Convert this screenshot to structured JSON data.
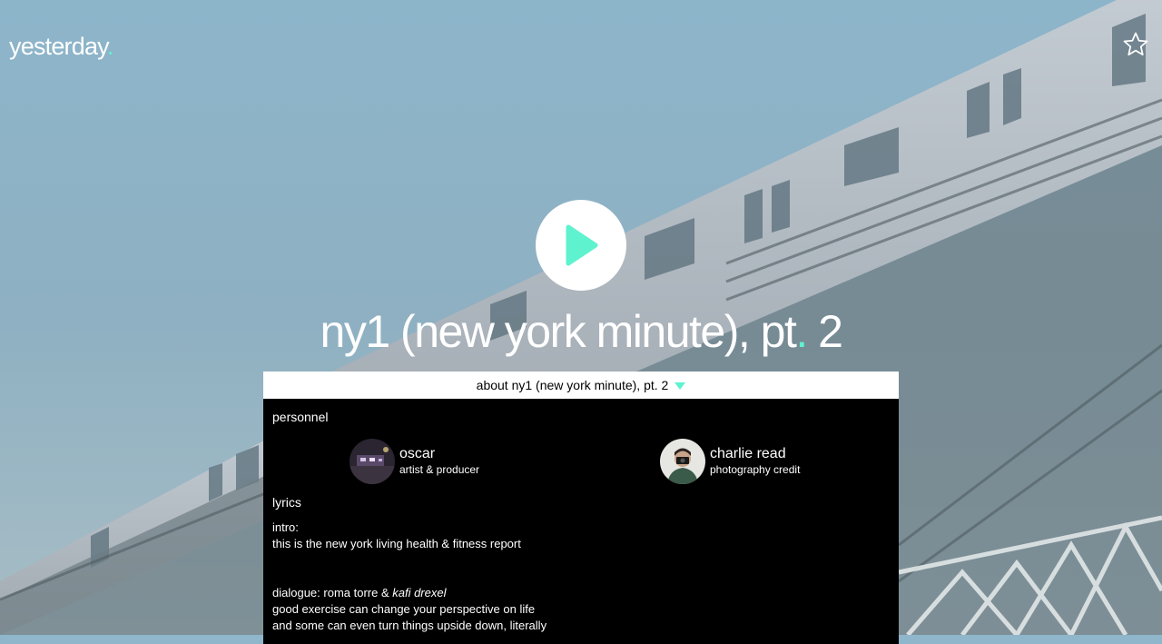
{
  "brand": {
    "name": "yesterday",
    "dot": "."
  },
  "track": {
    "title": "ny1 (new york minute), pt",
    "title_dot": ".",
    "title_end": " 2",
    "about_label": "about ny1 (new york minute), pt. 2"
  },
  "personnel": {
    "label": "personnel",
    "people": [
      {
        "name": "oscar",
        "role": "artist & producer"
      },
      {
        "name": "charlie read",
        "role": "photography credit"
      }
    ]
  },
  "lyrics": {
    "label": "lyrics",
    "intro_heading": "intro:",
    "intro_line": "this is the new york living health & fitness report",
    "dialogue_heading": "dialogue: roma torre & ",
    "dialogue_heading_italic": "kafi drexel",
    "dialogue_lines": [
      "good exercise can change your perspective on life",
      "and some can even turn things upside down, literally"
    ]
  },
  "icons": {
    "favorite": "star-outline-icon",
    "play": "play-icon",
    "expand": "caret-down-icon"
  },
  "colors": {
    "accent": "#5ff2cf",
    "panel": "#000000",
    "bar": "#ffffff"
  }
}
